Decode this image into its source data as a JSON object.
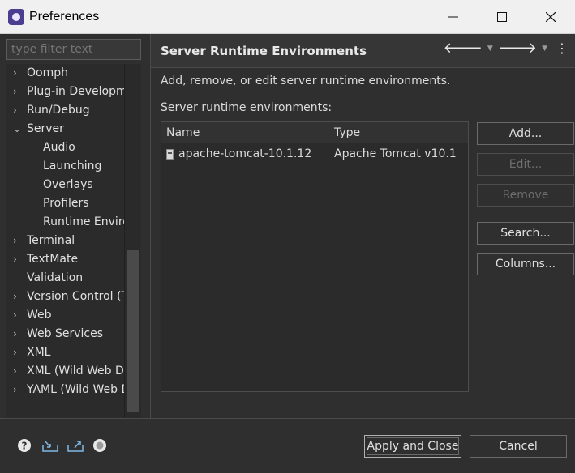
{
  "window": {
    "title": "Preferences",
    "minimize_icon": "minimize-icon",
    "maximize_icon": "maximize-icon",
    "close_icon": "close-icon"
  },
  "filter": {
    "placeholder": "type filter text",
    "value": ""
  },
  "tree": {
    "items": [
      {
        "label": "Oomph",
        "expander": "›",
        "child": false
      },
      {
        "label": "Plug-in Developm",
        "expander": "›",
        "child": false
      },
      {
        "label": "Run/Debug",
        "expander": "›",
        "child": false
      },
      {
        "label": "Server",
        "expander": "⌄",
        "child": false
      },
      {
        "label": "Audio",
        "expander": "",
        "child": true
      },
      {
        "label": "Launching",
        "expander": "",
        "child": true
      },
      {
        "label": "Overlays",
        "expander": "",
        "child": true
      },
      {
        "label": "Profilers",
        "expander": "",
        "child": true
      },
      {
        "label": "Runtime Enviro",
        "expander": "",
        "child": true
      },
      {
        "label": "Terminal",
        "expander": "›",
        "child": false
      },
      {
        "label": "TextMate",
        "expander": "›",
        "child": false
      },
      {
        "label": "Validation",
        "expander": "",
        "child": false
      },
      {
        "label": "Version Control (Te",
        "expander": "›",
        "child": false
      },
      {
        "label": "Web",
        "expander": "›",
        "child": false
      },
      {
        "label": "Web Services",
        "expander": "›",
        "child": false
      },
      {
        "label": "XML",
        "expander": "›",
        "child": false
      },
      {
        "label": "XML (Wild Web De",
        "expander": "›",
        "child": false
      },
      {
        "label": "YAML (Wild Web D",
        "expander": "›",
        "child": false
      }
    ]
  },
  "page": {
    "title": "Server Runtime Environments",
    "description": "Add, remove, or edit server runtime environments.",
    "table_label": "Server runtime environments:",
    "columns": [
      "Name",
      "Type"
    ],
    "rows": [
      {
        "name": "apache-tomcat-10.1.12",
        "type": "Apache Tomcat v10.1"
      }
    ]
  },
  "buttons": {
    "add": "Add...",
    "edit": "Edit...",
    "remove": "Remove",
    "search": "Search...",
    "columns": "Columns...",
    "apply_close": "Apply and Close",
    "cancel": "Cancel"
  },
  "footer_icons": [
    "help-icon",
    "import-icon",
    "export-icon",
    "record-icon"
  ]
}
